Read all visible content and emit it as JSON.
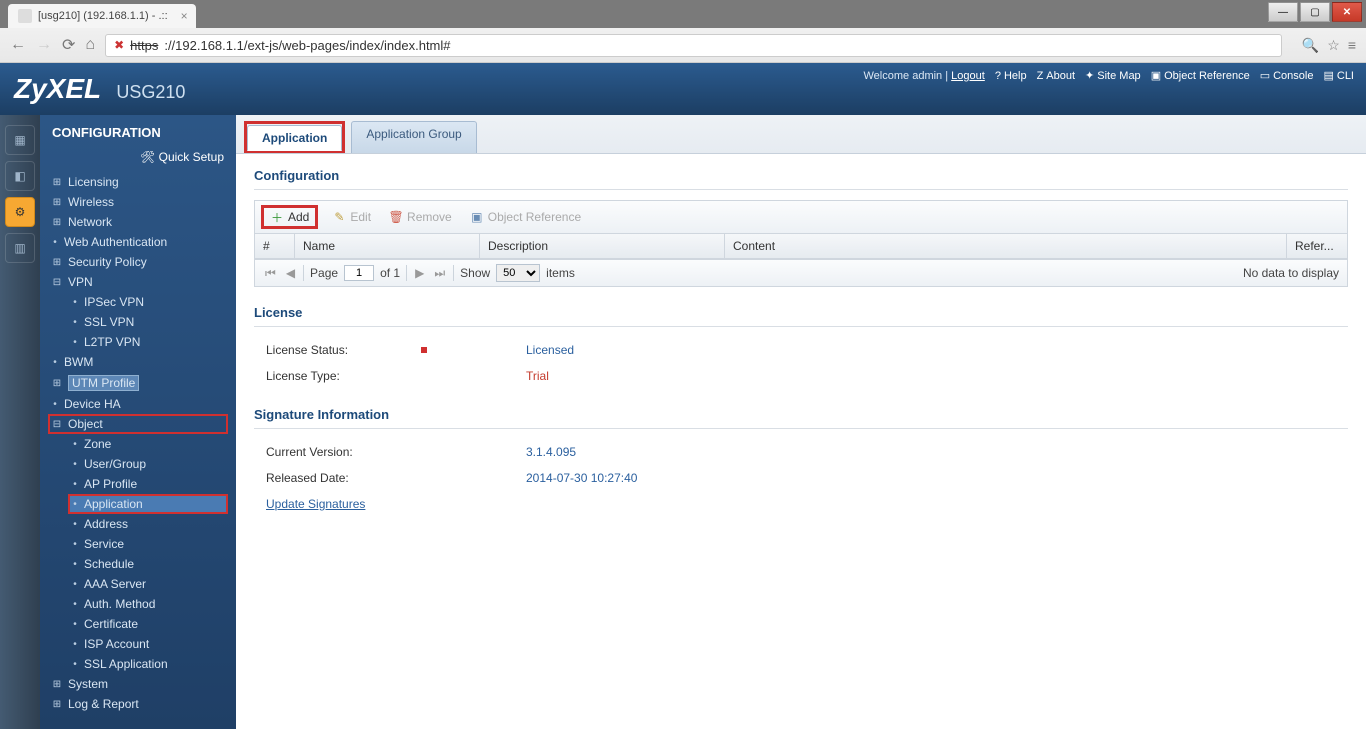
{
  "browser": {
    "tab_title": "[usg210] (192.168.1.1) - .::",
    "url_protocol": "https",
    "url_rest": "://192.168.1.1/ext-js/web-pages/index/index.html#"
  },
  "header": {
    "brand": "ZyXEL",
    "model": "USG210",
    "welcome_prefix": "Welcome ",
    "welcome_user": "admin",
    "logout": "Logout",
    "links": {
      "help": "Help",
      "about": "About",
      "sitemap": "Site Map",
      "objref": "Object Reference",
      "console": "Console",
      "cli": "CLI"
    }
  },
  "sidebar": {
    "title": "CONFIGURATION",
    "quick_setup": "Quick Setup",
    "items": {
      "licensing": "Licensing",
      "wireless": "Wireless",
      "network": "Network",
      "webauth": "Web Authentication",
      "security": "Security Policy",
      "vpn": "VPN",
      "ipsec": "IPSec VPN",
      "ssl": "SSL VPN",
      "l2tp": "L2TP VPN",
      "bwm": "BWM",
      "utm": "UTM Profile",
      "deviceha": "Device HA",
      "object": "Object",
      "zone": "Zone",
      "usergroup": "User/Group",
      "approfile": "AP Profile",
      "application": "Application",
      "address": "Address",
      "service": "Service",
      "schedule": "Schedule",
      "aaa": "AAA Server",
      "authmethod": "Auth. Method",
      "certificate": "Certificate",
      "ispaccount": "ISP Account",
      "sslapp": "SSL Application",
      "system": "System",
      "logreport": "Log & Report"
    }
  },
  "tabs": {
    "application": "Application",
    "appgroup": "Application Group"
  },
  "config": {
    "heading": "Configuration",
    "toolbar": {
      "add": "Add",
      "edit": "Edit",
      "remove": "Remove",
      "objref": "Object Reference"
    },
    "columns": {
      "num": "#",
      "name": "Name",
      "desc": "Description",
      "content": "Content",
      "refer": "Refer..."
    },
    "pager": {
      "page_label": "Page",
      "page_value": "1",
      "of_label": "of 1",
      "show_label": "Show",
      "page_size": "50",
      "items_label": "items",
      "nodata": "No data to display"
    }
  },
  "license": {
    "heading": "License",
    "status_label": "License Status:",
    "status_value": "Licensed",
    "type_label": "License Type:",
    "type_value": "Trial"
  },
  "siginfo": {
    "heading": "Signature Information",
    "version_label": "Current Version:",
    "version_value": "3.1.4.095",
    "released_label": "Released Date:",
    "released_value": "2014-07-30 10:27:40",
    "update_link": "Update Signatures"
  }
}
